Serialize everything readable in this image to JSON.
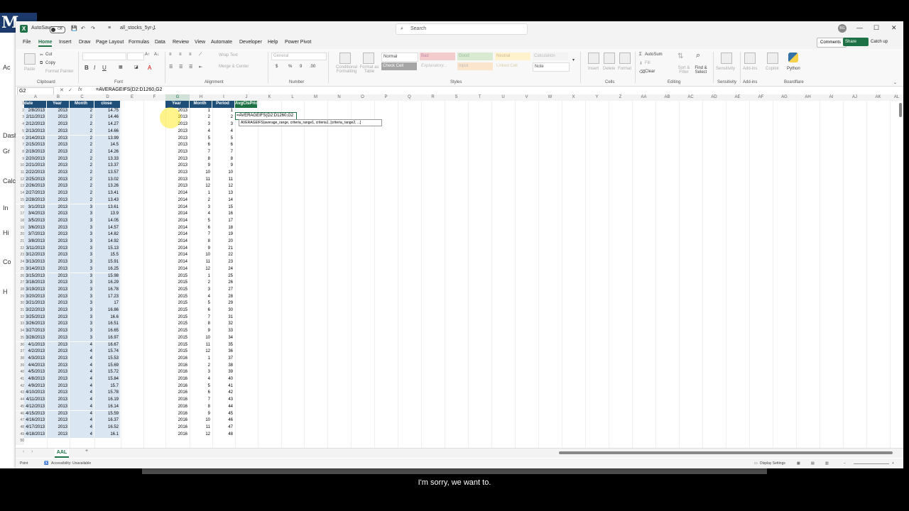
{
  "background": {
    "logo_letter": "M",
    "left_labels": [
      "Ac",
      "Dash",
      "Gr",
      "Calc",
      "In",
      "Hi",
      "Co",
      "H"
    ]
  },
  "titlebar": {
    "autosave_label": "AutoSave",
    "autosave_state": "Off",
    "filename": "all_stocks_5yr-1",
    "search_placeholder": "Search",
    "user_initials": "BG"
  },
  "menu": [
    "File",
    "Home",
    "Insert",
    "Draw",
    "Page Layout",
    "Formulas",
    "Data",
    "Review",
    "View",
    "Automate",
    "Developer",
    "Help",
    "Power Pivot"
  ],
  "menu_active": "Home",
  "actions": {
    "comments": "Comments",
    "share": "Share",
    "catch_up": "Catch up"
  },
  "ribbon": {
    "clipboard": {
      "cut": "Cut",
      "copy": "Copy",
      "format_painter": "Format Painter",
      "group": "Clipboard",
      "paste": "Paste"
    },
    "font": {
      "group": "Font"
    },
    "alignment": {
      "wrap": "Wrap Text",
      "merge": "Merge & Center",
      "group": "Alignment"
    },
    "number": {
      "format": "General",
      "group": "Number"
    },
    "styles": {
      "conditional": "Conditional Formatting",
      "format_as_table": "Format as Table",
      "normal": "Normal",
      "bad": "Bad",
      "good": "Good",
      "neutral": "Neutral",
      "calculation": "Calculation",
      "check_cell": "Check Cell",
      "explanatory": "Explanatory...",
      "input": "Input",
      "linked_cell": "Linked Cell",
      "note": "Note",
      "group": "Styles"
    },
    "cells": {
      "insert": "Insert",
      "delete": "Delete",
      "format": "Format",
      "group": "Cells"
    },
    "editing": {
      "autosum": "AutoSum",
      "fill": "Fill",
      "clear": "Clear",
      "sort": "Sort & Filter",
      "find": "Find & Select",
      "group": "Editing"
    },
    "sensitivity": {
      "label": "Sensitivity",
      "group": "Sensitivity"
    },
    "addins": {
      "label": "Add-ins",
      "group": "Add-ins"
    },
    "copilot": "Copilot",
    "python": "Python",
    "boardflare": "Boardflare"
  },
  "formula_bar": {
    "name_box": "G2",
    "fx": "fx",
    "formula": "=AVERAGEIFS(D2:D1260,G2"
  },
  "columns": [
    "A",
    "B",
    "C",
    "D",
    "E",
    "F",
    "G",
    "H",
    "I",
    "J",
    "K",
    "L",
    "M",
    "N",
    "O",
    "P",
    "Q",
    "R",
    "S",
    "T",
    "U",
    "V",
    "W",
    "X",
    "Y",
    "Z",
    "AA",
    "AB",
    "AC",
    "AD",
    "AE",
    "AF",
    "AG",
    "AH",
    "AI",
    "AJ",
    "AK",
    "AL"
  ],
  "headers_left": [
    "date",
    "Year",
    "Month",
    "close"
  ],
  "headers_right": [
    "Year",
    "Month",
    "Period",
    "AvgClsPrice"
  ],
  "rows_left": [
    [
      "2/8/2013",
      "2013",
      "2",
      "14.75"
    ],
    [
      "2/11/2013",
      "2013",
      "2",
      "14.46"
    ],
    [
      "2/12/2013",
      "2013",
      "2",
      "14.27"
    ],
    [
      "2/13/2013",
      "2013",
      "2",
      "14.66"
    ],
    [
      "2/14/2013",
      "2013",
      "2",
      "13.99"
    ],
    [
      "2/15/2013",
      "2013",
      "2",
      "14.5"
    ],
    [
      "2/19/2013",
      "2013",
      "2",
      "14.26"
    ],
    [
      "2/20/2013",
      "2013",
      "2",
      "13.33"
    ],
    [
      "2/21/2013",
      "2013",
      "2",
      "13.37"
    ],
    [
      "2/22/2013",
      "2013",
      "2",
      "13.57"
    ],
    [
      "2/25/2013",
      "2013",
      "2",
      "13.02"
    ],
    [
      "2/26/2013",
      "2013",
      "2",
      "13.26"
    ],
    [
      "2/27/2013",
      "2013",
      "2",
      "13.41"
    ],
    [
      "2/28/2013",
      "2013",
      "2",
      "13.43"
    ],
    [
      "3/1/2013",
      "2013",
      "3",
      "13.61"
    ],
    [
      "3/4/2013",
      "2013",
      "3",
      "13.9"
    ],
    [
      "3/5/2013",
      "2013",
      "3",
      "14.05"
    ],
    [
      "3/6/2013",
      "2013",
      "3",
      "14.57"
    ],
    [
      "3/7/2013",
      "2013",
      "3",
      "14.82"
    ],
    [
      "3/8/2013",
      "2013",
      "3",
      "14.92"
    ],
    [
      "3/11/2013",
      "2013",
      "3",
      "15.13"
    ],
    [
      "3/12/2013",
      "2013",
      "3",
      "15.5"
    ],
    [
      "3/13/2013",
      "2013",
      "3",
      "15.91"
    ],
    [
      "3/14/2013",
      "2013",
      "3",
      "16.25"
    ],
    [
      "3/15/2013",
      "2013",
      "3",
      "15.98"
    ],
    [
      "3/18/2013",
      "2013",
      "3",
      "16.29"
    ],
    [
      "3/19/2013",
      "2013",
      "3",
      "16.78"
    ],
    [
      "3/20/2013",
      "2013",
      "3",
      "17.23"
    ],
    [
      "3/21/2013",
      "2013",
      "3",
      "17"
    ],
    [
      "3/22/2013",
      "2013",
      "3",
      "16.86"
    ],
    [
      "3/25/2013",
      "2013",
      "3",
      "16.6"
    ],
    [
      "3/26/2013",
      "2013",
      "3",
      "16.51"
    ],
    [
      "3/27/2013",
      "2013",
      "3",
      "16.65"
    ],
    [
      "3/28/2013",
      "2013",
      "3",
      "16.97"
    ],
    [
      "4/1/2013",
      "2013",
      "4",
      "16.67"
    ],
    [
      "4/2/2013",
      "2013",
      "4",
      "15.74"
    ],
    [
      "4/3/2013",
      "2013",
      "4",
      "15.53"
    ],
    [
      "4/4/2013",
      "2013",
      "4",
      "15.69"
    ],
    [
      "4/5/2013",
      "2013",
      "4",
      "15.72"
    ],
    [
      "4/8/2013",
      "2013",
      "4",
      "15.84"
    ],
    [
      "4/9/2013",
      "2013",
      "4",
      "15.7"
    ],
    [
      "4/10/2013",
      "2013",
      "4",
      "15.78"
    ],
    [
      "4/11/2013",
      "2013",
      "4",
      "16.19"
    ],
    [
      "4/12/2013",
      "2013",
      "4",
      "16.14"
    ],
    [
      "4/15/2013",
      "2013",
      "4",
      "15.59"
    ],
    [
      "4/16/2013",
      "2013",
      "4",
      "16.37"
    ],
    [
      "4/17/2013",
      "2013",
      "4",
      "16.52"
    ],
    [
      "4/18/2013",
      "2013",
      "4",
      "16.1"
    ]
  ],
  "rows_right": [
    [
      "2013",
      "1",
      "1"
    ],
    [
      "2013",
      "2",
      "2"
    ],
    [
      "2013",
      "3",
      "3"
    ],
    [
      "2013",
      "4",
      "4"
    ],
    [
      "2013",
      "5",
      "5"
    ],
    [
      "2013",
      "6",
      "6"
    ],
    [
      "2013",
      "7",
      "7"
    ],
    [
      "2013",
      "8",
      "8"
    ],
    [
      "2013",
      "9",
      "9"
    ],
    [
      "2013",
      "10",
      "10"
    ],
    [
      "2013",
      "11",
      "11"
    ],
    [
      "2013",
      "12",
      "12"
    ],
    [
      "2014",
      "1",
      "13"
    ],
    [
      "2014",
      "2",
      "14"
    ],
    [
      "2014",
      "3",
      "15"
    ],
    [
      "2014",
      "4",
      "16"
    ],
    [
      "2014",
      "5",
      "17"
    ],
    [
      "2014",
      "6",
      "18"
    ],
    [
      "2014",
      "7",
      "19"
    ],
    [
      "2014",
      "8",
      "20"
    ],
    [
      "2014",
      "9",
      "21"
    ],
    [
      "2014",
      "10",
      "22"
    ],
    [
      "2014",
      "11",
      "23"
    ],
    [
      "2014",
      "12",
      "24"
    ],
    [
      "2015",
      "1",
      "25"
    ],
    [
      "2015",
      "2",
      "26"
    ],
    [
      "2015",
      "3",
      "27"
    ],
    [
      "2015",
      "4",
      "28"
    ],
    [
      "2015",
      "5",
      "29"
    ],
    [
      "2015",
      "6",
      "30"
    ],
    [
      "2015",
      "7",
      "31"
    ],
    [
      "2015",
      "8",
      "32"
    ],
    [
      "2015",
      "9",
      "33"
    ],
    [
      "2015",
      "10",
      "34"
    ],
    [
      "2015",
      "11",
      "35"
    ],
    [
      "2015",
      "12",
      "36"
    ],
    [
      "2016",
      "1",
      "37"
    ],
    [
      "2016",
      "2",
      "38"
    ],
    [
      "2016",
      "3",
      "39"
    ],
    [
      "2016",
      "4",
      "40"
    ],
    [
      "2016",
      "5",
      "41"
    ],
    [
      "2016",
      "6",
      "42"
    ],
    [
      "2016",
      "7",
      "43"
    ],
    [
      "2016",
      "8",
      "44"
    ],
    [
      "2016",
      "9",
      "45"
    ],
    [
      "2016",
      "10",
      "46"
    ],
    [
      "2016",
      "11",
      "47"
    ],
    [
      "2016",
      "12",
      "48"
    ]
  ],
  "active_cell_text": "=AVERAGEIFS(D2:D1260,G2",
  "tooltip": "AVERAGEIFS(average_range, criteria_range1, criteria1, [criteria_range2, ...]",
  "sheet_tab": "AAL",
  "status": {
    "mode": "Point",
    "accessibility": "Accessibility: Unavailable",
    "display": "Display Settings"
  },
  "caption": "I'm sorry, we want to."
}
